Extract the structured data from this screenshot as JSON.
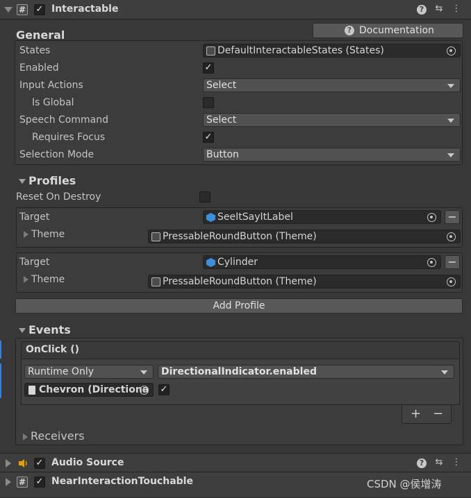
{
  "interactable": {
    "title": "Interactable",
    "header_icon": "#",
    "help_icon": "?",
    "presets_icon": "⇆",
    "menu_icon": "⋮",
    "enabled": true
  },
  "general": {
    "title": "General",
    "documentation_label": "Documentation",
    "help_icon": "?",
    "states_label": "States",
    "states_value": "DefaultInteractableStates (States)",
    "enabled_label": "Enabled",
    "enabled": true,
    "input_actions_label": "Input Actions",
    "input_actions_value": "Select",
    "is_global_label": "Is Global",
    "is_global": false,
    "speech_command_label": "Speech Command",
    "speech_command_value": "Select",
    "requires_focus_label": "Requires Focus",
    "requires_focus": true,
    "selection_mode_label": "Selection Mode",
    "selection_mode_value": "Button"
  },
  "profiles": {
    "title": "Profiles",
    "reset_on_destroy_label": "Reset On Destroy",
    "reset_on_destroy": false,
    "items": [
      {
        "target_label": "Target",
        "target_value": "SeeItSayItLabel",
        "theme_label": "Theme",
        "theme_value": "PressableRoundButton (Theme)",
        "remove_label": "−"
      },
      {
        "target_label": "Target",
        "target_value": "Cylinder",
        "theme_label": "Theme",
        "theme_value": "PressableRoundButton (Theme)",
        "remove_label": "−"
      }
    ],
    "add_profile_label": "Add Profile"
  },
  "events": {
    "title": "Events",
    "onclick_label": "OnClick ()",
    "runtime_value": "Runtime Only",
    "function_value": "DirectionalIndicator.enabled",
    "object_value": "Chevron (Directiona",
    "argument_checked": true,
    "add_label": "+",
    "remove_label": "−",
    "receivers_label": "Receivers"
  },
  "components": [
    {
      "title": "Audio Source",
      "enabled": true
    },
    {
      "title": "NearInteractionTouchable",
      "enabled": true
    }
  ],
  "watermark": "CSDN @侯增涛",
  "check_glyph": "✓"
}
